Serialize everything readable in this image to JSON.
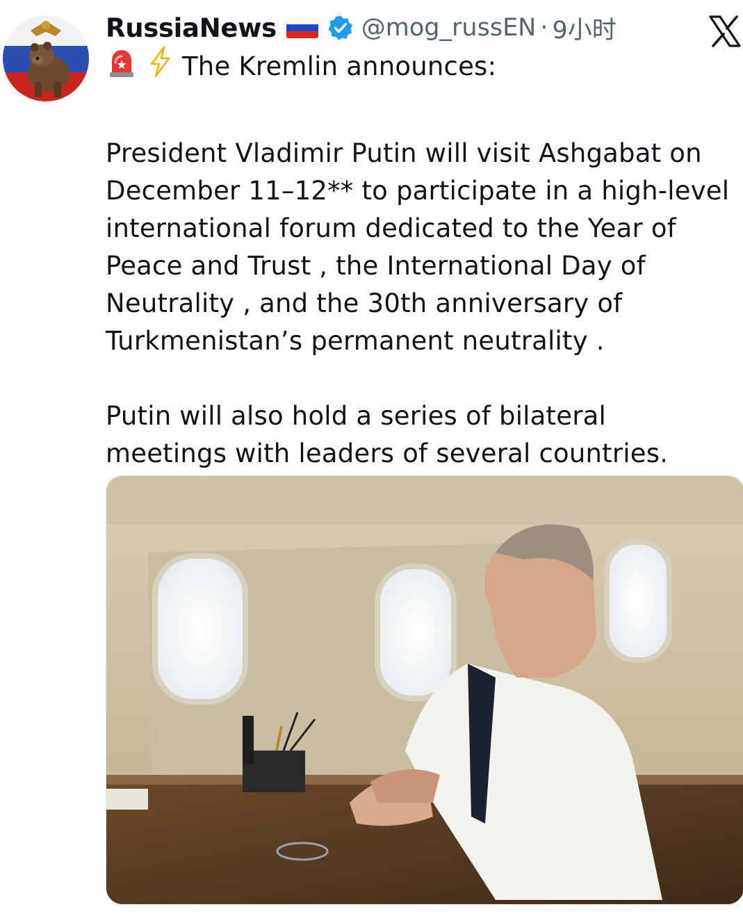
{
  "user": {
    "display_name": "RussiaNews",
    "flag_icon": "russia-flag-icon",
    "verified_icon": "verified-badge-icon",
    "handle": "@mog_russEN",
    "separator": "·",
    "time": "9小时"
  },
  "icons": {
    "emoji_1": "police-light-icon",
    "emoji_2": "lightning-icon",
    "platform_logo": "x-logo-icon"
  },
  "post": {
    "headline": "The Kremlin announces:",
    "paragraph1_lines": [
      "President Vladimir Putin will visit Ashgabat on",
      "December 11–12** to participate in a high-level",
      "international forum dedicated to the  Year of",
      "Peace and Trust , the  International Day of",
      "Neutrality , and the  30th anniversary of",
      "Turkmenistan’s permanent neutrality ."
    ],
    "paragraph2_lines": [
      "Putin will also hold a series of  bilateral",
      "meetings  with leaders of several countries."
    ]
  },
  "colors": {
    "verified_blue": "#1d9bf0",
    "secondary_text": "#536471",
    "primary_text": "#0f1419"
  }
}
